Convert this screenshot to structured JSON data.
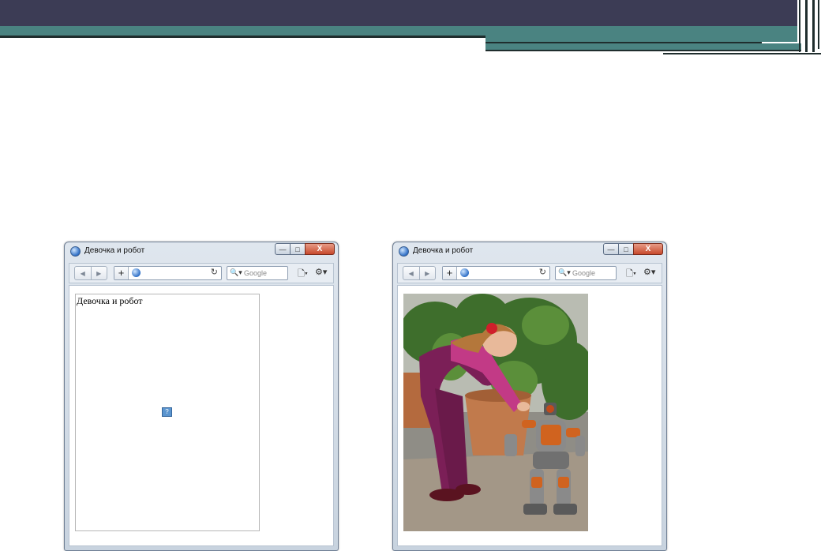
{
  "windows": [
    {
      "title": "Девочка и робот",
      "search_placeholder": "Google",
      "content": {
        "type": "broken-image",
        "alt_text": "Девочка и робот"
      }
    },
    {
      "title": "Девочка и робот",
      "search_placeholder": "Google",
      "content": {
        "type": "photo",
        "subject": "girl-and-robot"
      }
    }
  ],
  "icons": {
    "back": "◀",
    "forward": "▶",
    "new_tab": "+",
    "reload": "↻",
    "search": "🔍▾",
    "page": "🗋▾",
    "gear": "⚙▾",
    "minimize": "—",
    "maximize": "□",
    "close": "X",
    "broken_image": "?"
  },
  "colors": {
    "header_dark": "#3c3c55",
    "header_teal": "#4a8381",
    "close_button": "#c7492c"
  }
}
